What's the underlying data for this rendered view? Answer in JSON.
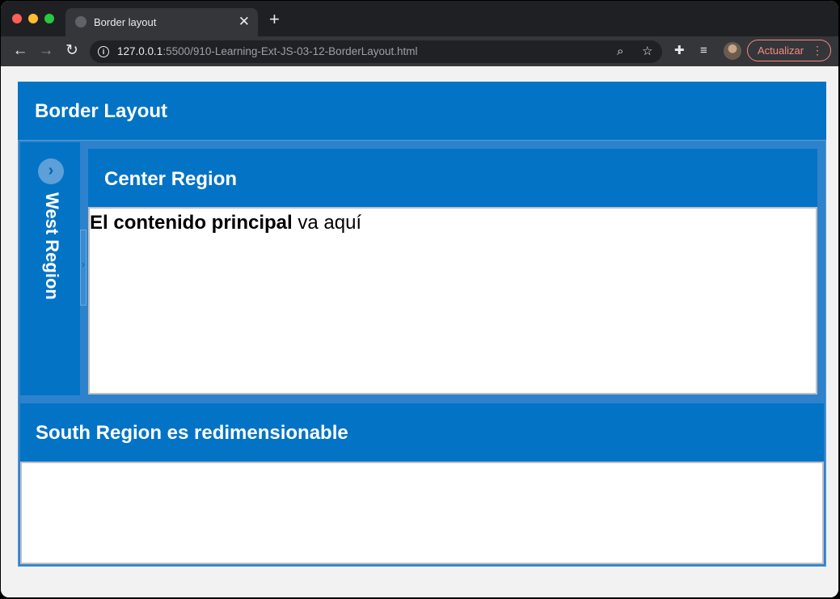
{
  "browser": {
    "tab_title": "Border layout",
    "tab_close": "✕",
    "new_tab": "+",
    "url_host": "127.0.0.1",
    "url_rest": ":5500/910-Learning-Ext-JS-03-12-BorderLayout.html",
    "update_label": "Actualizar",
    "update_menu": "⋮"
  },
  "page": {
    "main_title": "Border Layout",
    "west_title": "West Region",
    "west_toggle": "›",
    "center_title": "Center Region",
    "center_text_bold": "El contenido principal",
    "center_text_rest": " va aquí",
    "south_title": "South Region es redimensionable"
  },
  "colors": {
    "panel_blue": "#0373c5",
    "frame_blue": "#2e82cc",
    "update_accent": "#f28b82"
  }
}
